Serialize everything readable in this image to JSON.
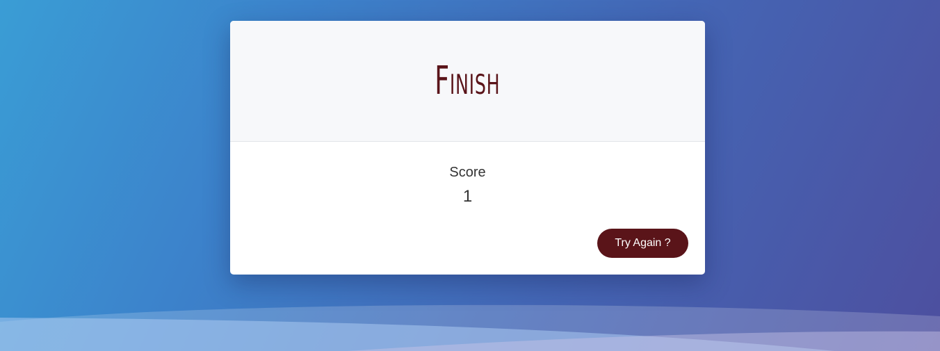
{
  "card": {
    "title": "Finish",
    "score_label": "Score",
    "score_value": "1",
    "button_label": "Try Again ?"
  },
  "colors": {
    "accent": "#5a1419",
    "background_start": "#3a9dd5",
    "background_end": "#4d4f9f",
    "card_header": "#f7f8fa"
  }
}
